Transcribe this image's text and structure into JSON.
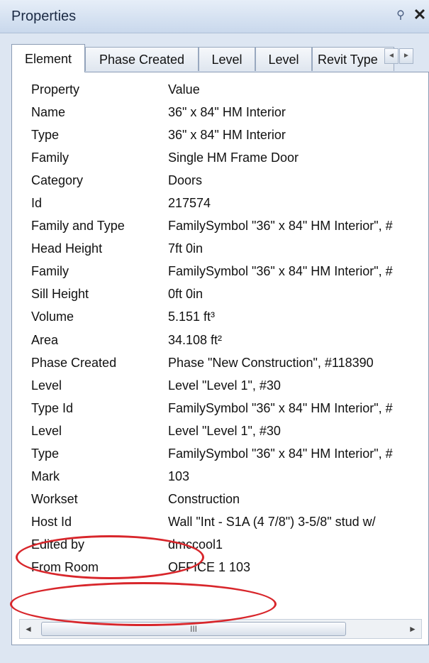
{
  "window": {
    "title": "Properties",
    "pin_glyph": "⚲",
    "close_glyph": "✕"
  },
  "tabs": [
    {
      "label": "Element",
      "active": true
    },
    {
      "label": "Phase Created"
    },
    {
      "label": "Level"
    },
    {
      "label": "Level"
    },
    {
      "label": "Revit Type"
    }
  ],
  "tab_scroll": {
    "left": "◄",
    "right": "►"
  },
  "table": {
    "header": {
      "property": "Property",
      "value": "Value"
    },
    "rows": [
      {
        "property": "Name",
        "value": "36\" x 84\" HM Interior"
      },
      {
        "property": "Type",
        "value": "36\" x 84\" HM Interior"
      },
      {
        "property": "Family",
        "value": "Single HM Frame Door"
      },
      {
        "property": "Category",
        "value": "Doors"
      },
      {
        "property": "Id",
        "value": "217574"
      },
      {
        "property": "Family and Type",
        "value": "FamilySymbol \"36\" x 84\" HM Interior\", #"
      },
      {
        "property": "Head Height",
        "value": "7ft 0in"
      },
      {
        "property": "Family",
        "value": "FamilySymbol \"36\" x 84\" HM Interior\", #"
      },
      {
        "property": "Sill Height",
        "value": "0ft 0in"
      },
      {
        "property": "Volume",
        "value": "5.151 ft³"
      },
      {
        "property": "Area",
        "value": "34.108 ft²"
      },
      {
        "property": "Phase Created",
        "value": "Phase \"New Construction\", #118390"
      },
      {
        "property": "Level",
        "value": "Level \"Level 1\", #30"
      },
      {
        "property": "Type Id",
        "value": "FamilySymbol \"36\" x 84\" HM Interior\", #"
      },
      {
        "property": "Level",
        "value": "Level \"Level 1\", #30"
      },
      {
        "property": "Type",
        "value": "FamilySymbol \"36\" x 84\" HM Interior\", #"
      },
      {
        "property": "Mark",
        "value": "103"
      },
      {
        "property": "Workset",
        "value": "Construction"
      },
      {
        "property": "Host Id",
        "value": "Wall \"Int - S1A (4 7/8\") 3-5/8\" stud w/"
      },
      {
        "property": "Edited by",
        "value": "dmccool1"
      },
      {
        "property": "From Room",
        "value": "OFFICE 1 103"
      }
    ]
  },
  "scrollbar": {
    "left_arrow": "◄",
    "right_arrow": "►",
    "thumb_grip": "III"
  },
  "colors": {
    "annotation": "#d8262b",
    "title_bar": "#c9d8ec"
  }
}
